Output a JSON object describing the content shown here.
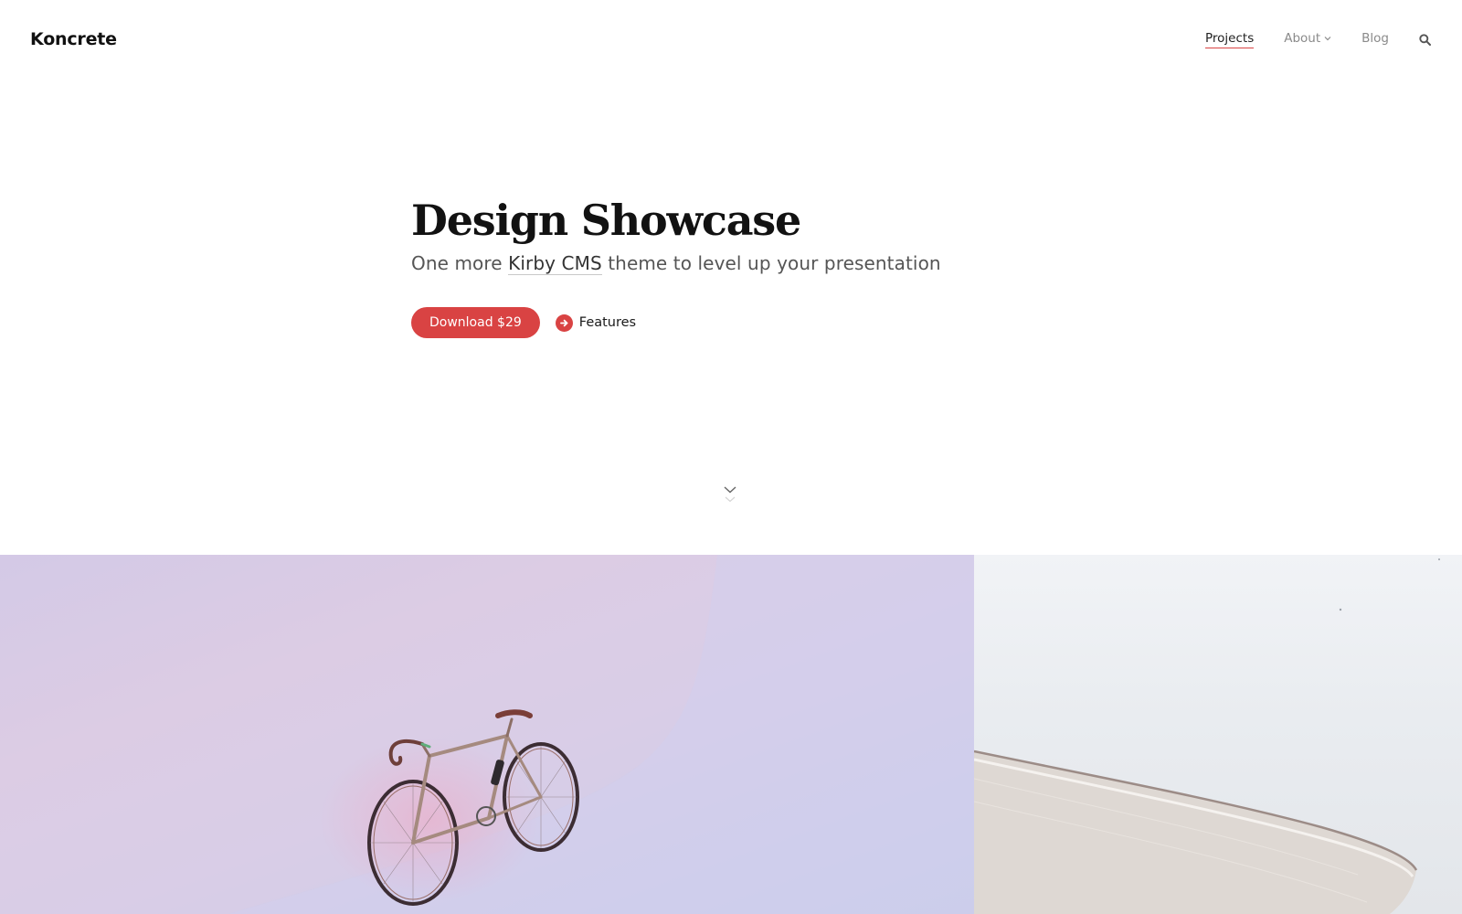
{
  "header": {
    "logo": "Koncrete",
    "nav": [
      {
        "label": "Projects",
        "active": true
      },
      {
        "label": "About",
        "has_dropdown": true
      },
      {
        "label": "Blog"
      }
    ],
    "search_icon": "search-icon"
  },
  "hero": {
    "title": "Design Showcase",
    "subtitle_before": "One more ",
    "subtitle_link": "Kirby CMS",
    "subtitle_after": " theme to level up your presentation",
    "download_label": "Download $29",
    "features_label": "Features",
    "features_icon": "arrow-right-circle-icon"
  },
  "scroll_indicator": "double-chevron-down-icon",
  "gallery": [
    {
      "subject": "road bicycle against pastel pink-lilac backdrop"
    },
    {
      "subject": "curved white architectural canopy against pale sky"
    }
  ],
  "colors": {
    "accent": "#d94343",
    "text": "#1a1a1a",
    "muted": "#8a8a8a"
  }
}
